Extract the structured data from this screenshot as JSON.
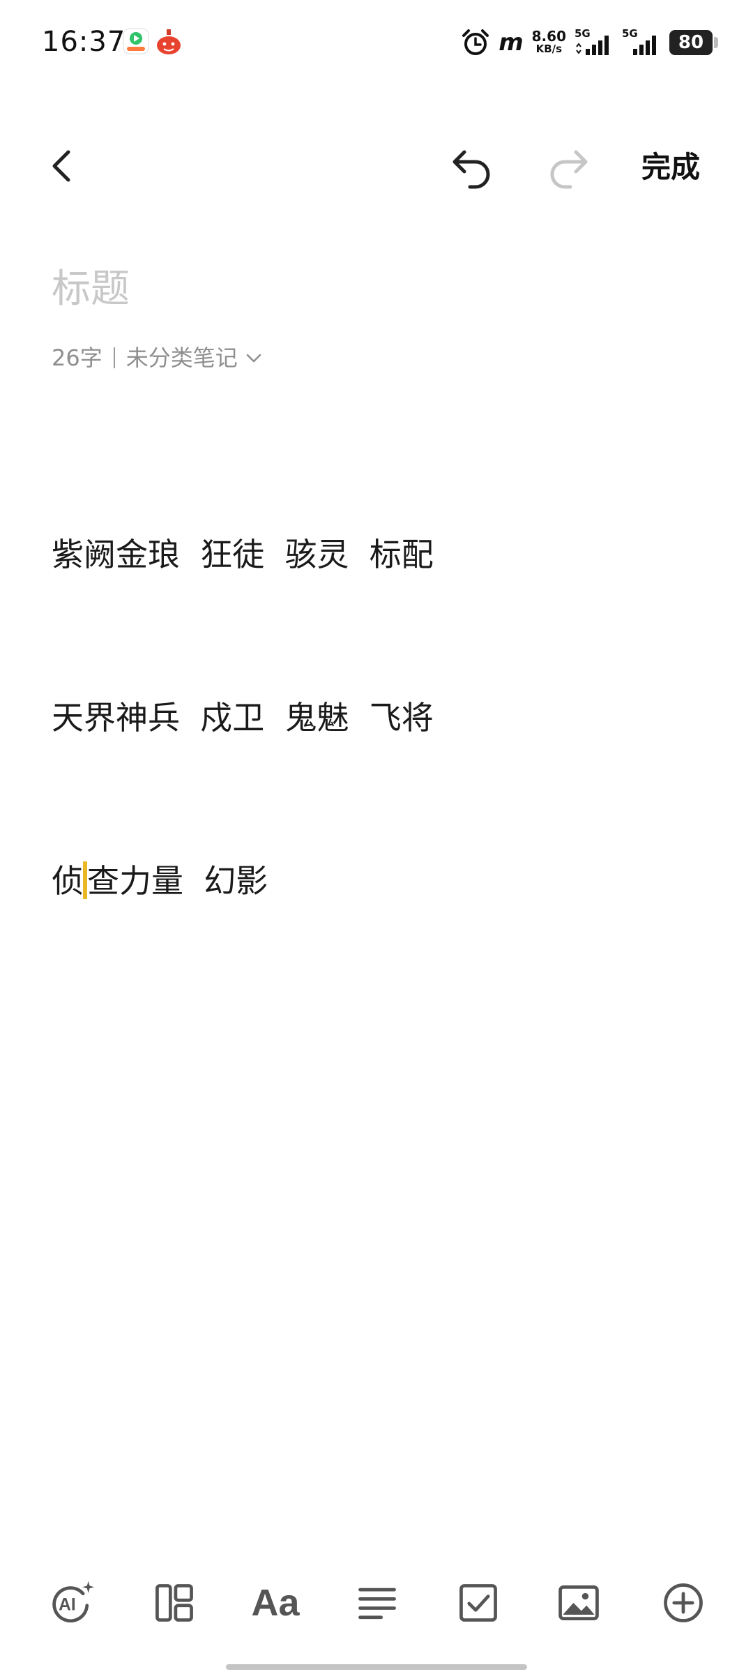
{
  "status_bar": {
    "time": "16:37",
    "net_speed_value": "8.60",
    "net_speed_unit": "KB/s",
    "network_1": "5G",
    "network_2": "5G",
    "battery": "80",
    "carrier_mark": "m"
  },
  "toolbar": {
    "back_icon": "chevron-left-icon",
    "undo_icon": "undo-icon",
    "redo_icon": "redo-icon",
    "done_label": "完成"
  },
  "note": {
    "title_placeholder": "标题",
    "word_count": "26字",
    "category": "未分类笔记",
    "lines": [
      "紫阙金琅  狂徒  骇灵  标配",
      "天界神兵  戍卫  鬼魅  飞将"
    ],
    "line3_before_cursor": "侦",
    "line3_after_cursor": "查力量  幻影"
  },
  "bottom_toolbar": {
    "ai_icon": "ai-sparkle-icon",
    "layout_icon": "layout-icon",
    "text_format_label": "Aa",
    "align_icon": "align-left-icon",
    "checklist_icon": "checkbox-icon",
    "image_icon": "image-icon",
    "add_icon": "add-circle-icon"
  },
  "colors": {
    "cursor": "#e9b824",
    "icon": "#555555",
    "placeholder": "#c8c8c8",
    "meta": "#8f8f8f"
  }
}
